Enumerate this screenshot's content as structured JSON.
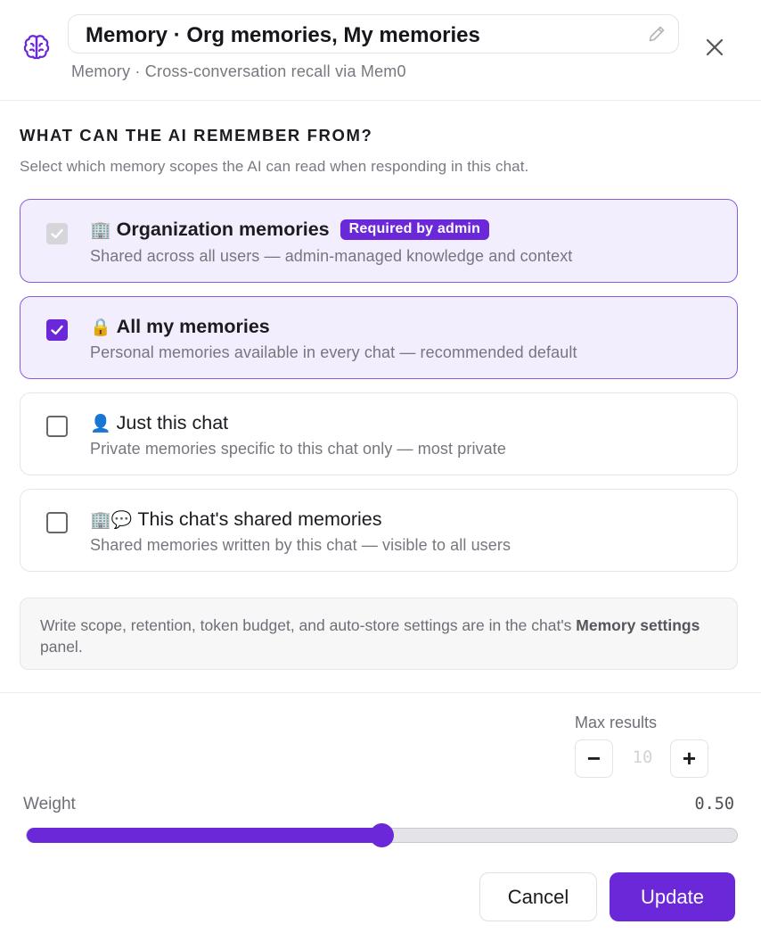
{
  "header": {
    "icon": "brain-icon",
    "title": "Memory · Org memories, My memories",
    "subtitle": "Memory · Cross-conversation recall via Mem0"
  },
  "section": {
    "title": "WHAT CAN THE AI REMEMBER FROM?",
    "description": "Select which memory scopes the AI can read when responding in this chat."
  },
  "scopes": [
    {
      "emoji": "🏢",
      "label": "Organization memories",
      "badge": "Required by admin",
      "description": "Shared across all users — admin-managed knowledge and context",
      "checked": true,
      "disabled": true
    },
    {
      "emoji": "🔒",
      "label": "All my memories",
      "description": "Personal memories available in every chat — recommended default",
      "checked": true,
      "disabled": false
    },
    {
      "emoji": "👤",
      "label": "Just this chat",
      "description": "Private memories specific to this chat only — most private",
      "checked": false,
      "disabled": false
    },
    {
      "emoji": "🏢💬",
      "label": "This chat's shared memories",
      "description": "Shared memories written by this chat — visible to all users",
      "checked": false,
      "disabled": false
    }
  ],
  "note": {
    "text_before": "Write scope, retention, token budget, and auto-store settings are in the chat's ",
    "bold": "Memory settings",
    "text_after": " panel."
  },
  "max_results": {
    "label": "Max results",
    "value": "10",
    "decrement": "−",
    "increment": "+"
  },
  "weight": {
    "label": "Weight",
    "value": "0.50",
    "fraction": 0.5
  },
  "buttons": {
    "cancel": "Cancel",
    "update": "Update"
  },
  "colors": {
    "accent": "#6a28d9",
    "selected_bg": "#f3eefd"
  }
}
